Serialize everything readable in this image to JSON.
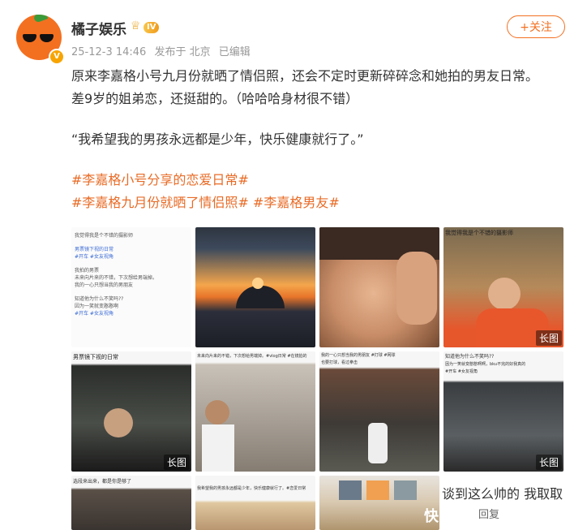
{
  "account": {
    "name": "橘子娱乐",
    "level": "IV",
    "verified_mark": "V"
  },
  "meta": {
    "time": "25-12-3 14:46",
    "location": "发布于 北京",
    "edited": "已编辑"
  },
  "follow_label": "+关注",
  "post": {
    "line1": "原来李嘉格小号九月份就晒了情侣照，还会不定时更新碎碎念和她拍的男友日常。",
    "line2": "差9岁的姐弟恋，还挺甜的。（哈哈哈身材很不错）",
    "quote": "“我希望我的男孩永远都是少年，快乐健康就行了。”",
    "tag1": "#李嘉格小号分享的恋爱日常#",
    "tag2": "#李嘉格九月份就晒了情侣照#",
    "tag3": "#李嘉格男友#"
  },
  "images": [
    {
      "badge": "",
      "text": [
        "我觉得我是个不错的摄影师",
        "男票镜下视的日常",
        "#开车 #女友视角",
        "我拍的男票",
        "未来向片来的不错，下次想给男端掉。",
        "我的一心只想当我的男朋友",
        "知道他为什么不笑吗??",
        "因为一笑就变憨憨啊",
        "#开车 #女友视角"
      ]
    },
    {
      "badge": "",
      "text": []
    },
    {
      "badge": "",
      "text": []
    },
    {
      "badge": "长图",
      "text": [
        "我觉得我是个不错的摄影师"
      ]
    },
    {
      "badge": "长图",
      "text": [
        "男票镜下视的日常"
      ]
    },
    {
      "badge": "",
      "text": [
        "未来向片来的不错，下次想给男端掉。#vlog日常 #在镜拍的"
      ]
    },
    {
      "badge": "",
      "text": [
        "我的一心只想当我的男朋友 #打球 #网球",
        "也要打球，看过拳击"
      ]
    },
    {
      "badge": "长图",
      "text": [
        "知道他为什么不笑吗??",
        "因为一笑就变憨憨啊啊，bku不完的好我真的",
        "#开车 #女友视角"
      ]
    },
    {
      "badge": "",
      "text": [
        "选段来出来，都是你是够了"
      ]
    },
    {
      "badge": "",
      "text": [
        "我希望我的男孩永远都是少年，快乐健康就行了。#恋爱日常"
      ]
    },
    {
      "badge": "",
      "text": []
    }
  ],
  "comment": {
    "text": "谈到这么帅的 我取取",
    "reply": "回复",
    "watermark": "快"
  }
}
